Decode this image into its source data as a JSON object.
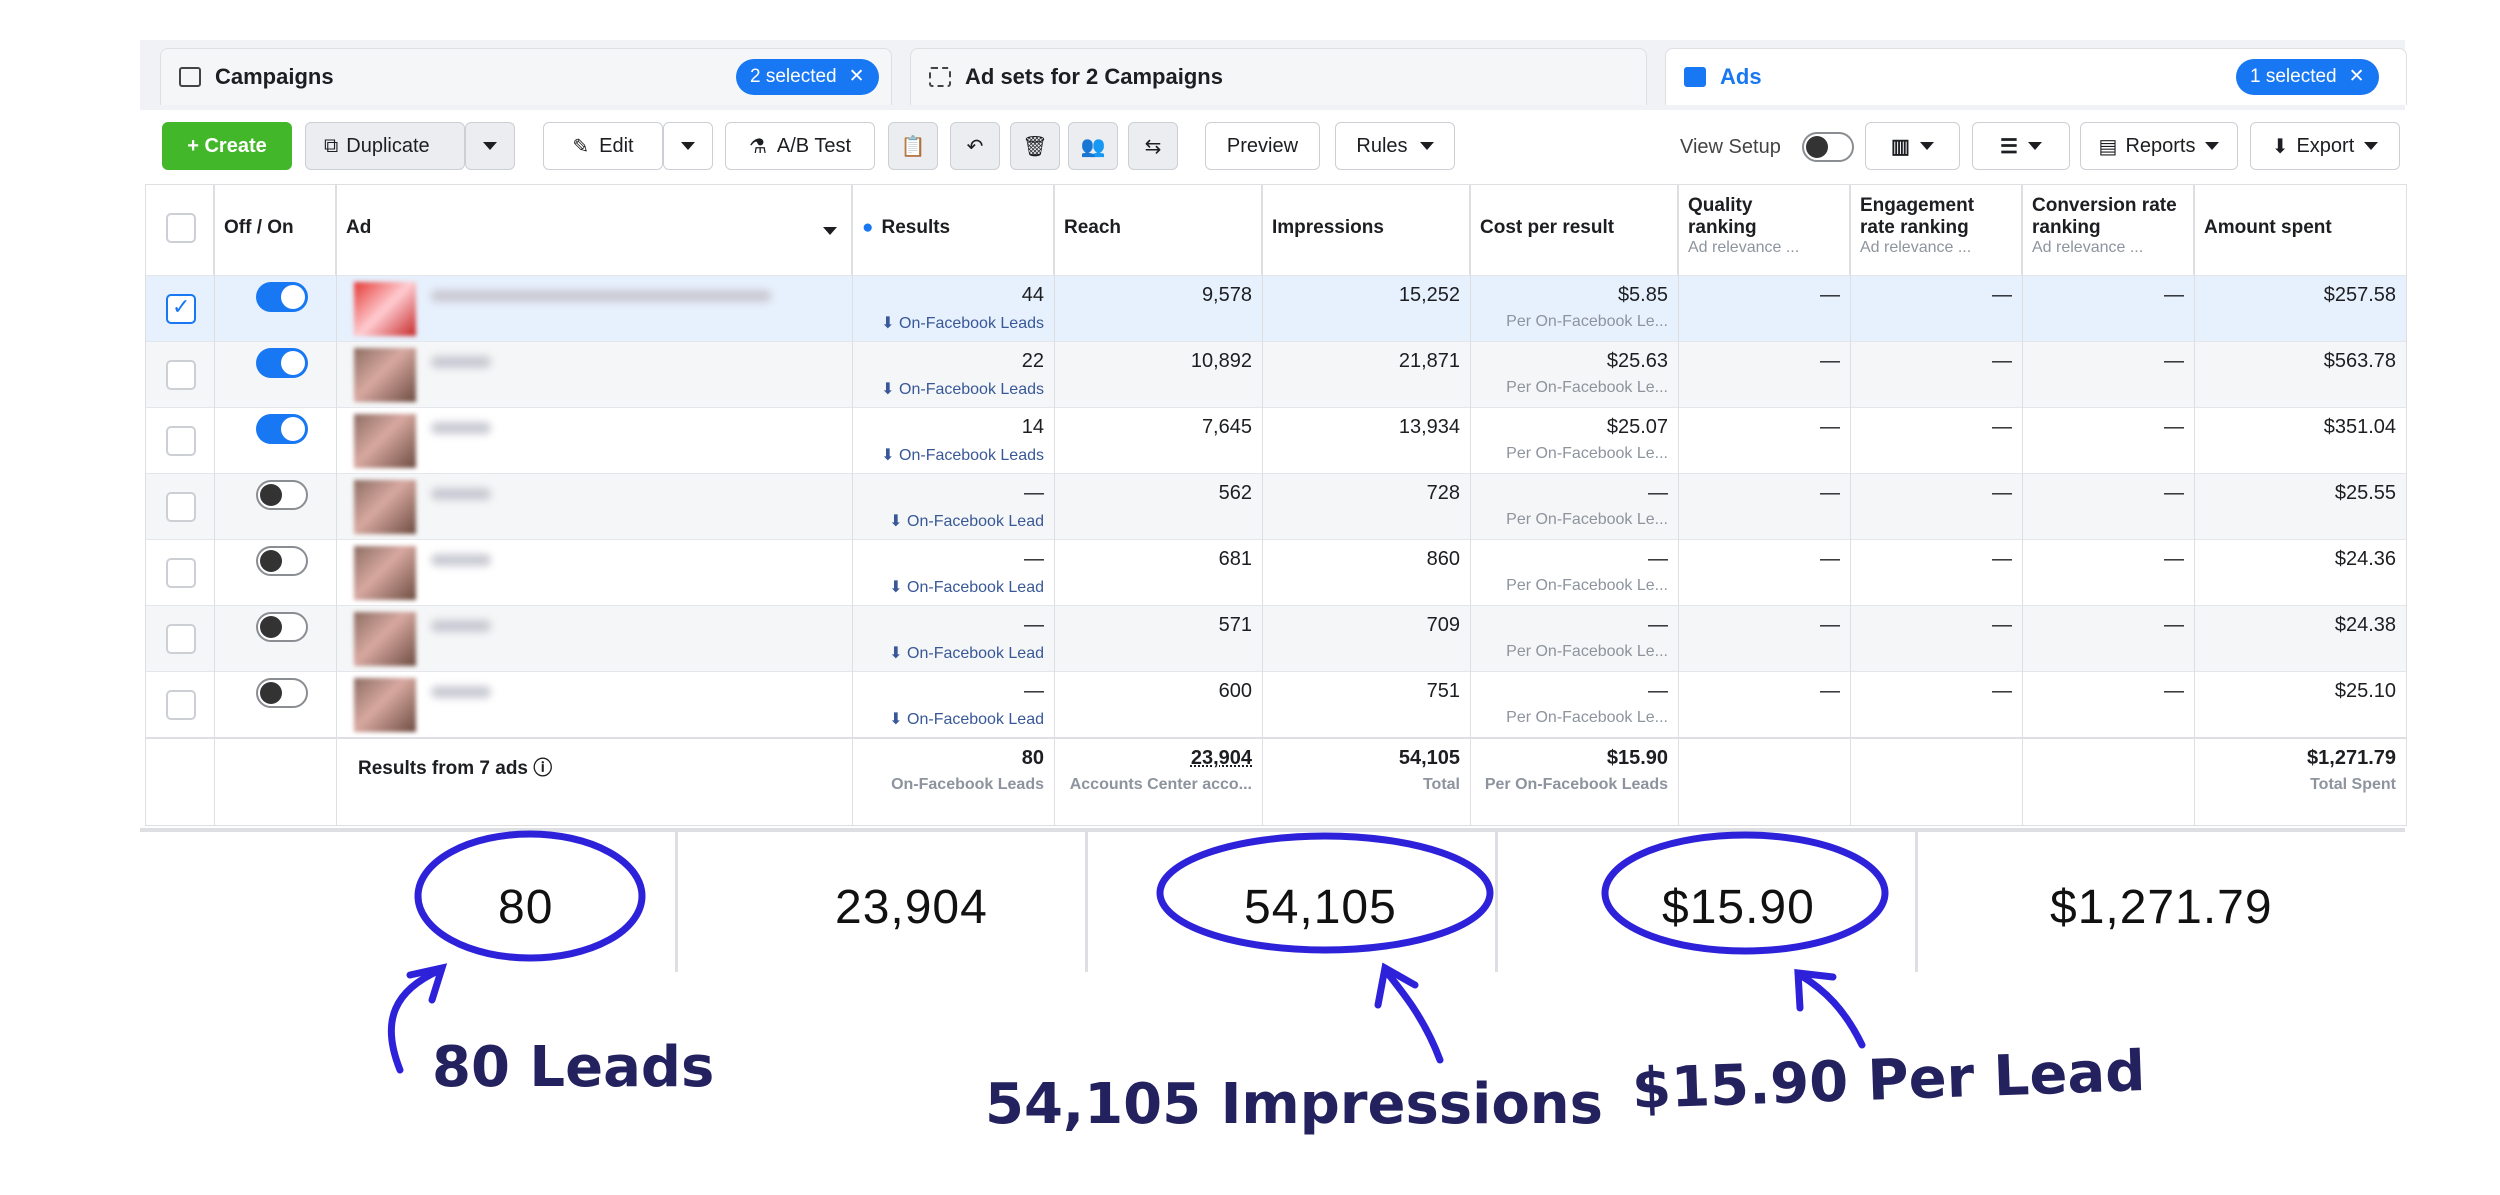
{
  "tabs": [
    {
      "label": "Campaigns",
      "badge": "2 selected"
    },
    {
      "label": "Ad sets for 2 Campaigns"
    },
    {
      "label": "Ads",
      "badge": "1 selected"
    }
  ],
  "toolbar": {
    "create": "+ Create",
    "duplicate": "Duplicate",
    "edit": "Edit",
    "ab_test": "A/B Test",
    "preview": "Preview",
    "rules": "Rules",
    "view_setup": "View Setup",
    "reports": "Reports",
    "export": "Export"
  },
  "headers": {
    "off_on": "Off / On",
    "ad": "Ad",
    "results": "Results",
    "reach": "Reach",
    "impressions": "Impressions",
    "cost_per_result": "Cost per result",
    "quality_ranking": "Quality ranking",
    "engagement_ranking": "Engagement rate ranking",
    "conversion_ranking": "Conversion rate ranking",
    "relevance_sub": "Ad relevance ...",
    "amount_spent": "Amount spent"
  },
  "rows": [
    {
      "results": "44",
      "result_type": "On-Facebook Leads",
      "reach": "9,578",
      "impressions": "15,252",
      "cost": "$5.85",
      "cost_sub": "Per On-Facebook Le...",
      "quality": "—",
      "engagement": "—",
      "conversion": "—",
      "spent": "$257.58"
    },
    {
      "results": "22",
      "result_type": "On-Facebook Leads",
      "reach": "10,892",
      "impressions": "21,871",
      "cost": "$25.63",
      "cost_sub": "Per On-Facebook Le...",
      "quality": "—",
      "engagement": "—",
      "conversion": "—",
      "spent": "$563.78"
    },
    {
      "results": "14",
      "result_type": "On-Facebook Leads",
      "reach": "7,645",
      "impressions": "13,934",
      "cost": "$25.07",
      "cost_sub": "Per On-Facebook Le...",
      "quality": "—",
      "engagement": "—",
      "conversion": "—",
      "spent": "$351.04"
    },
    {
      "results": "—",
      "result_type": "On-Facebook Lead",
      "reach": "562",
      "impressions": "728",
      "cost": "—",
      "cost_sub": "Per On-Facebook Le...",
      "quality": "—",
      "engagement": "—",
      "conversion": "—",
      "spent": "$25.55"
    },
    {
      "results": "—",
      "result_type": "On-Facebook Lead",
      "reach": "681",
      "impressions": "860",
      "cost": "—",
      "cost_sub": "Per On-Facebook Le...",
      "quality": "—",
      "engagement": "—",
      "conversion": "—",
      "spent": "$24.36"
    },
    {
      "results": "—",
      "result_type": "On-Facebook Lead",
      "reach": "571",
      "impressions": "709",
      "cost": "—",
      "cost_sub": "Per On-Facebook Le...",
      "quality": "—",
      "engagement": "—",
      "conversion": "—",
      "spent": "$24.38"
    },
    {
      "results": "—",
      "result_type": "On-Facebook Lead",
      "reach": "600",
      "impressions": "751",
      "cost": "—",
      "cost_sub": "Per On-Facebook Le...",
      "quality": "—",
      "engagement": "—",
      "conversion": "—",
      "spent": "$25.10"
    }
  ],
  "totals": {
    "label": "Results from 7 ads",
    "results": "80",
    "results_sub": "On-Facebook Leads",
    "reach": "23,904",
    "reach_sub": "Accounts Center acco...",
    "impressions": "54,105",
    "impressions_sub": "Total",
    "cost": "$15.90",
    "cost_sub": "Per On-Facebook Leads",
    "spent": "$1,271.79",
    "spent_sub": "Total Spent"
  },
  "summary": [
    "80",
    "23,904",
    "54,105",
    "$15.90",
    "$1,271.79"
  ],
  "annotations": {
    "leads": "80 Leads",
    "impressions": "54,105 Impressions",
    "per_lead": "$15.90 Per Lead"
  },
  "colors": {
    "accent": "#1877f2",
    "create_green": "#42b72a",
    "ink": "#2d22d9",
    "annot_text": "#24215f"
  }
}
